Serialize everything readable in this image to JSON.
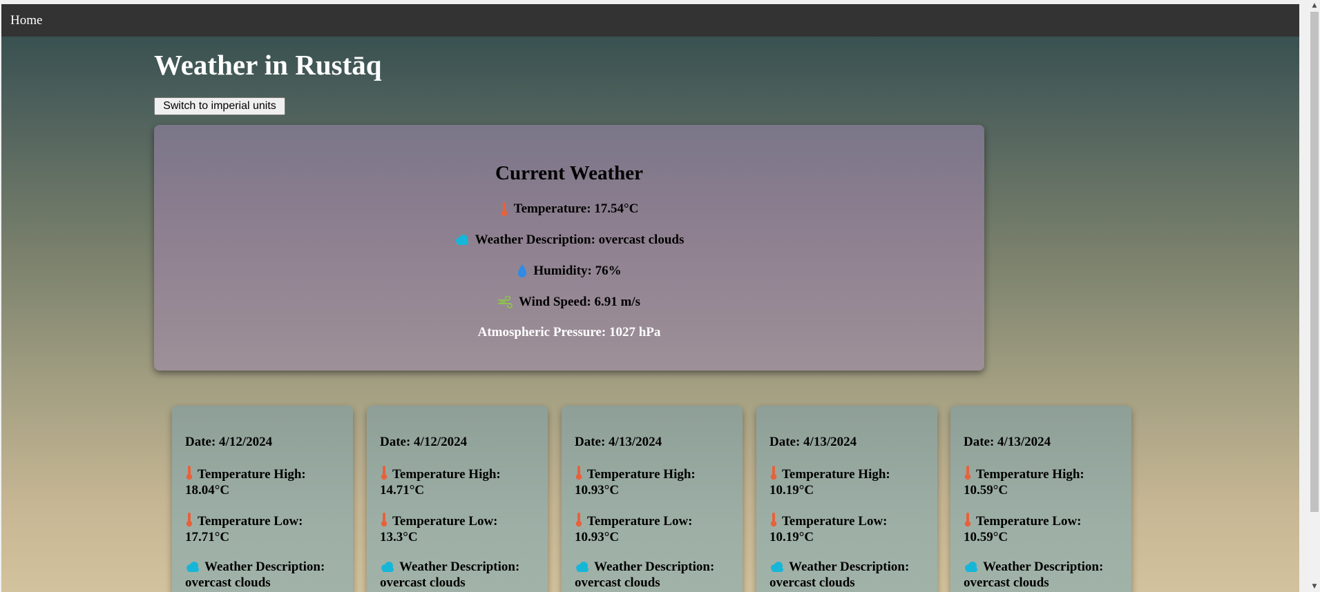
{
  "nav": {
    "home_label": "Home"
  },
  "page_title": "Weather in Rustāq",
  "unit_toggle_label": "Switch to imperial units",
  "current": {
    "heading": "Current Weather",
    "temperature": "Temperature: 17.54°C",
    "description": "Weather Description: overcast clouds",
    "humidity": "Humidity: 76%",
    "wind": "Wind Speed: 6.91 m/s",
    "pressure": "Atmospheric Pressure: 1027 hPa"
  },
  "icons": {
    "temperature": "thermometer-icon",
    "description": "cloud-icon",
    "humidity": "water-drop-icon",
    "wind": "wind-icon"
  },
  "colors": {
    "thermometer": "#e8613a",
    "cloud": "#17b6d8",
    "drop": "#2f8be6",
    "wind": "#8ec24a"
  },
  "forecast": [
    {
      "date": "Date: 4/12/2024",
      "high_label": "Temperature High:",
      "high_value": "18.04°C",
      "low_label": "Temperature Low:",
      "low_value": "17.71°C",
      "desc_label": "Weather Description:",
      "desc_value": "overcast clouds"
    },
    {
      "date": "Date: 4/12/2024",
      "high_label": "Temperature High:",
      "high_value": "14.71°C",
      "low_label": "Temperature Low:",
      "low_value": "13.3°C",
      "desc_label": "Weather Description:",
      "desc_value": "overcast clouds"
    },
    {
      "date": "Date: 4/13/2024",
      "high_label": "Temperature High:",
      "high_value": "10.93°C",
      "low_label": "Temperature Low:",
      "low_value": "10.93°C",
      "desc_label": "Weather Description:",
      "desc_value": "overcast clouds"
    },
    {
      "date": "Date: 4/13/2024",
      "high_label": "Temperature High:",
      "high_value": "10.19°C",
      "low_label": "Temperature Low:",
      "low_value": "10.19°C",
      "desc_label": "Weather Description:",
      "desc_value": "overcast clouds"
    },
    {
      "date": "Date: 4/13/2024",
      "high_label": "Temperature High:",
      "high_value": "10.59°C",
      "low_label": "Temperature Low:",
      "low_value": "10.59°C",
      "desc_label": "Weather Description:",
      "desc_value": "overcast clouds"
    }
  ]
}
